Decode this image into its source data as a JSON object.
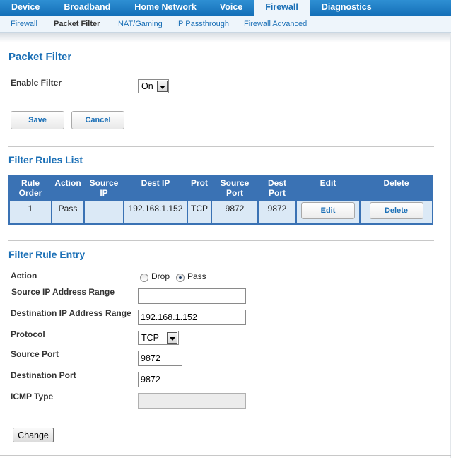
{
  "nav": {
    "tabs": [
      {
        "label": "Device"
      },
      {
        "label": "Broadband"
      },
      {
        "label": "Home Network"
      },
      {
        "label": "Voice"
      },
      {
        "label": "Firewall",
        "active": true
      },
      {
        "label": "Diagnostics"
      }
    ],
    "subtabs": [
      {
        "label": "Firewall"
      },
      {
        "label": "Packet Filter",
        "active": true
      },
      {
        "label": "NAT/Gaming"
      },
      {
        "label": "IP Passthrough"
      },
      {
        "label": "Firewall Advanced"
      }
    ]
  },
  "packet_filter": {
    "title": "Packet Filter",
    "enable_label": "Enable Filter",
    "enable_value": "On",
    "save_label": "Save",
    "cancel_label": "Cancel"
  },
  "rules_list": {
    "title": "Filter Rules List",
    "headers": [
      "Rule Order",
      "Action",
      "Source IP",
      "Dest IP",
      "Prot",
      "Source Port",
      "Dest Port",
      "Edit",
      "Delete"
    ],
    "rows": [
      {
        "order": "1",
        "action": "Pass",
        "source_ip": "",
        "dest_ip": "192.168.1.152",
        "prot": "TCP",
        "source_port": "9872",
        "dest_port": "9872",
        "edit_label": "Edit",
        "delete_label": "Delete"
      }
    ]
  },
  "entry": {
    "title": "Filter Rule Entry",
    "action_label": "Action",
    "action_options": [
      "Drop",
      "Pass"
    ],
    "action_selected": "Pass",
    "source_ip_label": "Source IP Address Range",
    "source_ip_value": "",
    "dest_ip_label": "Destination IP Address Range",
    "dest_ip_value": "192.168.1.152",
    "protocol_label": "Protocol",
    "protocol_value": "TCP",
    "source_port_label": "Source Port",
    "source_port_value": "9872",
    "dest_port_label": "Destination Port",
    "dest_port_value": "9872",
    "icmp_label": "ICMP Type",
    "icmp_value": "",
    "change_label": "Change"
  },
  "colors": {
    "nav_blue": "#1570b8",
    "heading_blue": "#1a6fb6",
    "table_header": "#3a72b4",
    "table_cell": "#dbe9f6"
  }
}
